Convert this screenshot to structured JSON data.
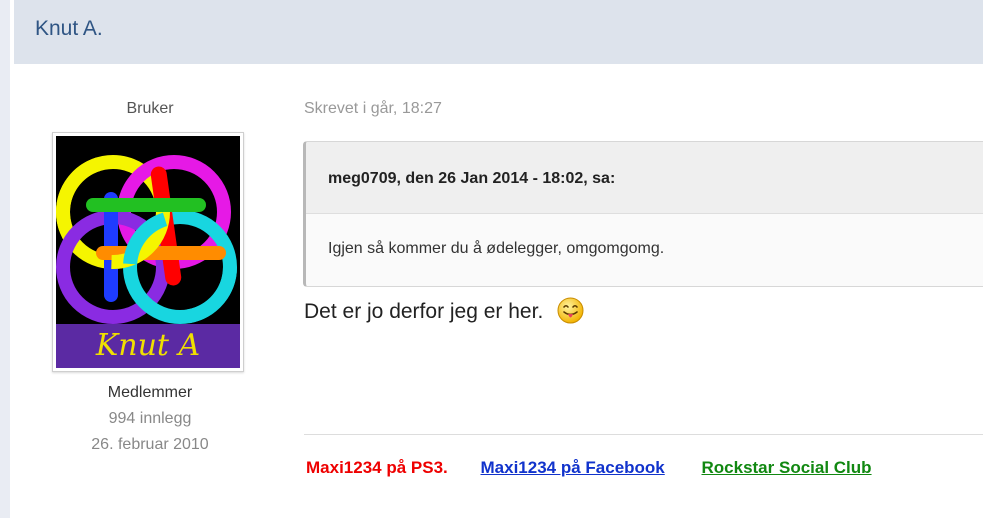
{
  "post": {
    "author": "Knut A.",
    "author_title": "Bruker",
    "avatar_label": "Knut A",
    "member_group": "Medlemmer",
    "post_count": "994 innlegg",
    "join_date": "26. februar 2010",
    "timestamp": "Skrevet i går, 18:27",
    "quote": {
      "citation": "meg0709, den 26 Jan 2014 - 18:02, sa:",
      "text": "Igjen så kommer du å ødelegger, omgomgomg."
    },
    "body": "Det er jo derfor jeg er her.",
    "emoticon": "tongue-smiley-icon"
  },
  "signature": {
    "ps3": "Maxi1234 på PS3.",
    "facebook": "Maxi1234 på Facebook",
    "rockstar": "Rockstar Social Club"
  },
  "colors": {
    "header_bg": "#dde3ec",
    "author_link": "#2f5584",
    "sig_ps3": "#ee0000",
    "sig_facebook": "#1133cc",
    "sig_rockstar": "#118811"
  }
}
